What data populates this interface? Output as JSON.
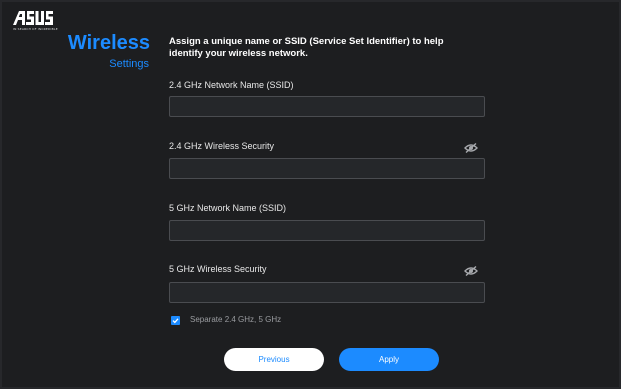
{
  "brand": {
    "logo": "ASUS",
    "tagline": "IN SEARCH OF INCREDIBLE"
  },
  "page": {
    "title": "Wireless",
    "subtitle": "Settings",
    "intro": "Assign a unique name or SSID (Service Set Identifier) to help identify your wireless network."
  },
  "fields": {
    "ssid_24": {
      "label": "2.4 GHz Network Name (SSID)",
      "value": "",
      "placeholder": ""
    },
    "security_24": {
      "label": "2.4 GHz Wireless Security",
      "value": "",
      "placeholder": "",
      "icon": "eye-off-icon"
    },
    "ssid_5": {
      "label": "5 GHz Network Name (SSID)",
      "value": "",
      "placeholder": ""
    },
    "security_5": {
      "label": "5 GHz Wireless Security",
      "value": "",
      "placeholder": "",
      "icon": "eye-off-icon"
    }
  },
  "separate": {
    "label": "Separate 2.4 GHz, 5 GHz",
    "checked": true
  },
  "buttons": {
    "previous": "Previous",
    "apply": "Apply"
  },
  "colors": {
    "accent": "#1c8bff",
    "background": "#1d1e20"
  }
}
